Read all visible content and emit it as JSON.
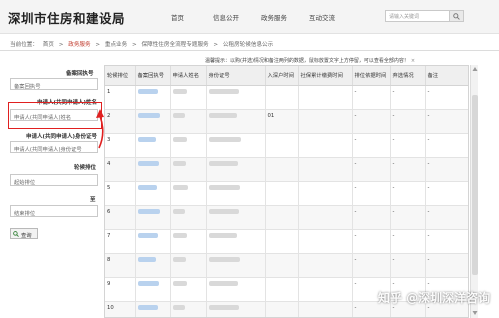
{
  "header": {
    "site_title": "深圳市住房和建设局",
    "nav": [
      "首页",
      "信息公开",
      "政务服务",
      "互动交流"
    ],
    "search_placeholder": "请输入关键词"
  },
  "breadcrumb": {
    "prefix": "当前位置：",
    "items": [
      "首页",
      "政务服务",
      "重点业务",
      "保障性住房全流程专题服务",
      "公租房轮候信息公示"
    ]
  },
  "sidebar": {
    "labels": {
      "wait_no": "备案回执号",
      "applicant_name": "申请人(共同申请人)姓名",
      "applicant_id": "申请人(共同申请人)身份证号",
      "queue_rank": "轮候排位",
      "to": "至"
    },
    "placeholders": {
      "wait_no": "备案回执号",
      "applicant_name": "申请人(共同申请人)姓名",
      "applicant_id": "申请人(共同申请人)身份证号",
      "start_rank": "起始排位",
      "end_rank": "结束排位"
    },
    "query_button": "查询"
  },
  "hint": {
    "text": "温馨提示：以购(并选)情况和备注两列的数据，鼠标放置文字上方停留，可以查看全部内容！",
    "close": "×"
  },
  "table": {
    "headers": [
      "轮候排位",
      "备案回执号",
      "申请人姓名",
      "身份证号",
      "入深户时间",
      "社保累计缴费时间",
      "排位依据时间",
      "弃选情况",
      "备注"
    ],
    "rows": [
      {
        "rank": "1",
        "hukou": "",
        "social": "",
        "basis": "-",
        "waive": "-",
        "note": "-"
      },
      {
        "rank": "2",
        "hukou": "01",
        "social": "",
        "basis": "-",
        "waive": "-",
        "note": "-"
      },
      {
        "rank": "3",
        "hukou": "",
        "social": "",
        "basis": "-",
        "waive": "-",
        "note": "-"
      },
      {
        "rank": "4",
        "hukou": "",
        "social": "",
        "basis": "-",
        "waive": "-",
        "note": "-"
      },
      {
        "rank": "5",
        "hukou": "",
        "social": "",
        "basis": "-",
        "waive": "-",
        "note": "-"
      },
      {
        "rank": "6",
        "hukou": "",
        "social": "",
        "basis": "-",
        "waive": "-",
        "note": "-"
      },
      {
        "rank": "7",
        "hukou": "",
        "social": "",
        "basis": "-",
        "waive": "-",
        "note": "-"
      },
      {
        "rank": "8",
        "hukou": "",
        "social": "",
        "basis": "-",
        "waive": "-",
        "note": "-"
      },
      {
        "rank": "9",
        "hukou": "",
        "social": "",
        "basis": "-",
        "waive": "-",
        "note": "-"
      },
      {
        "rank": "10",
        "hukou": "",
        "social": "",
        "basis": "-",
        "waive": "-",
        "note": "-"
      }
    ]
  },
  "watermark": "知乎 @深圳深洋咨询",
  "colors": {
    "highlight": "#e02020",
    "breadcrumb_link": "#c0392b",
    "blur_blue": "#b9d2ee",
    "blur_gray": "#d9d9d9"
  }
}
